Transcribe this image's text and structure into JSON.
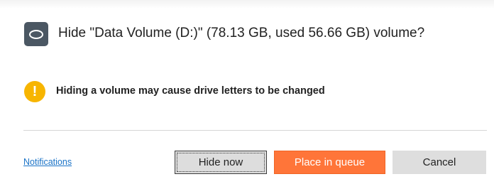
{
  "dialog": {
    "title": "Hide \"Data Volume (D:)\" (78.13 GB, used 56.66 GB) volume?",
    "header_icon": "disk-volume-icon",
    "warning": {
      "icon": "exclamation-icon",
      "glyph": "!",
      "text": "Hiding a volume may cause drive letters to be changed",
      "color": "#f7b500"
    }
  },
  "footer": {
    "notifications_link": "Notifications",
    "buttons": {
      "hide_now": "Hide now",
      "place_in_queue": "Place in queue",
      "cancel": "Cancel"
    },
    "accent_color": "#ff7539"
  }
}
